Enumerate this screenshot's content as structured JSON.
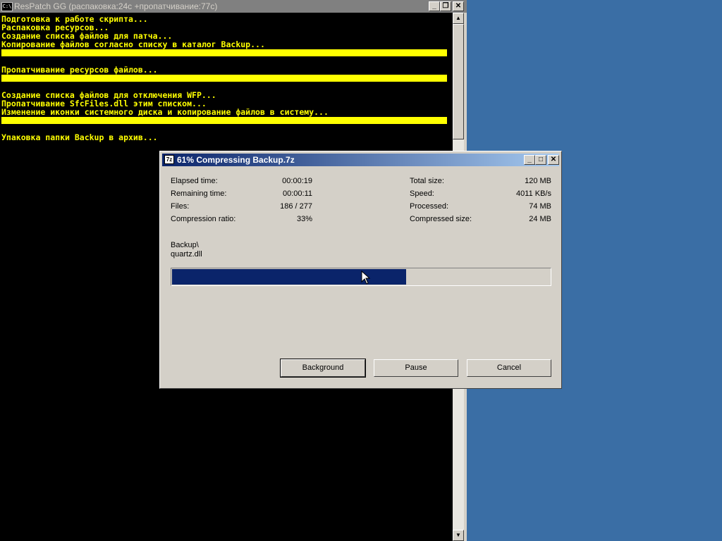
{
  "console": {
    "title": "ResPatch GG (распаковка:24с +пропатчивание:77с)",
    "icon": "console-icon",
    "lines": [
      "Подготовка к работе скрипта...",
      "Распаковка ресурсов...",
      "Создание списка файлов для патча...",
      "Копирование файлов согласно списку в каталог Backup...",
      "Пропатчивание ресурсов файлов...",
      "Создание списка файлов для отключения WFP...",
      "Пропатчивание SfcFiles.dll этим списком...",
      "Изменение иконки системного диска и копирование файлов в систему...",
      "Упаковка папки Backup в архив..."
    ],
    "text_color": "#ffff00"
  },
  "dialog": {
    "title": "61% Compressing Backup.7z",
    "icon_text": "7z",
    "stats_left": [
      {
        "label": "Elapsed time:",
        "value": "00:00:19"
      },
      {
        "label": "Remaining time:",
        "value": "00:00:11"
      },
      {
        "label": "Files:",
        "value": "186 / 277"
      },
      {
        "label": "Compression ratio:",
        "value": "33%"
      }
    ],
    "stats_right": [
      {
        "label": "Total size:",
        "value": "120 MB"
      },
      {
        "label": "Speed:",
        "value": "4011 KB/s"
      },
      {
        "label": "Processed:",
        "value": "74 MB"
      },
      {
        "label": "Compressed size:",
        "value": "24 MB"
      }
    ],
    "current_folder": "Backup\\",
    "current_file": "quartz.dll",
    "progress": 0.62,
    "buttons": {
      "background": "Background",
      "pause": "Pause",
      "cancel": "Cancel"
    }
  },
  "colors": {
    "desktop": "#3a6ea5",
    "progress_fill": "#0a246a",
    "dialog_title_start": "#0a246a"
  }
}
